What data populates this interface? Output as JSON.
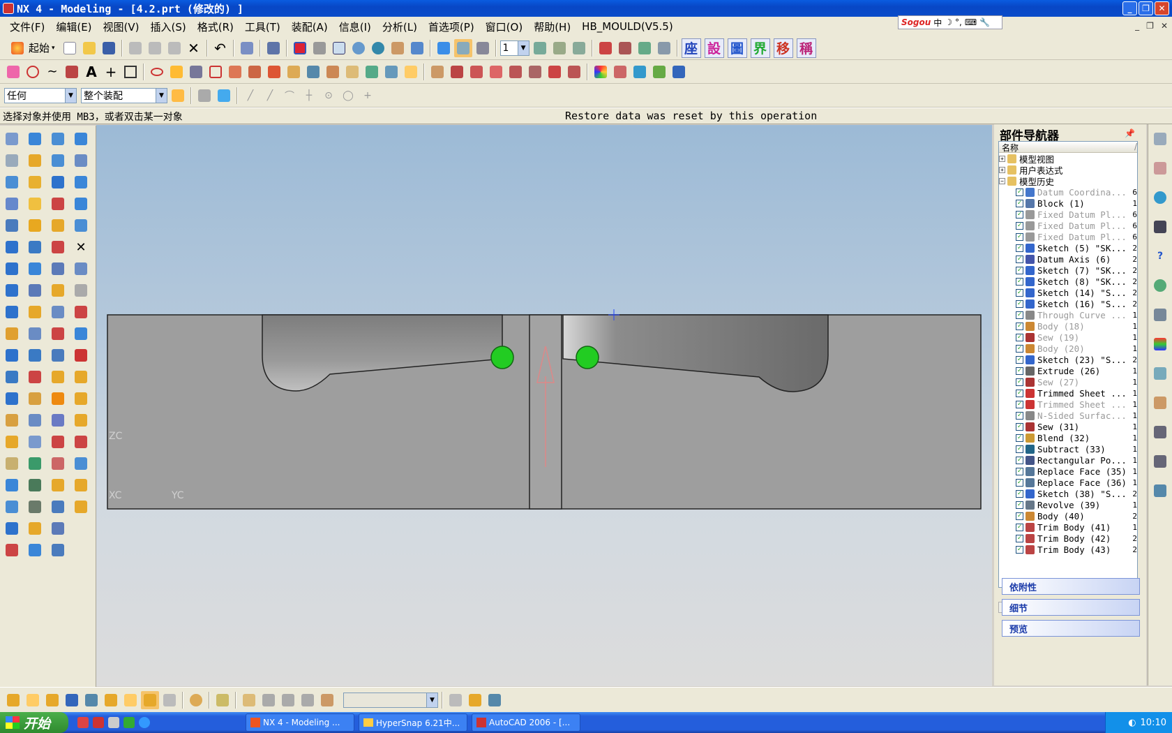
{
  "window": {
    "title": "NX 4 - Modeling - [4.2.prt  (修改的) ]",
    "minimize": "_",
    "restore": "❐",
    "close": "✕"
  },
  "menu": [
    "文件(F)",
    "编辑(E)",
    "视图(V)",
    "插入(S)",
    "格式(R)",
    "工具(T)",
    "装配(A)",
    "信息(I)",
    "分析(L)",
    "首选项(P)",
    "窗口(O)",
    "帮助(H)",
    "HB_MOULD(V5.5)"
  ],
  "ime": {
    "logo": "Sogou",
    "lang": "中"
  },
  "toolbar": {
    "start_label": "起始",
    "layer_value": "1",
    "filter_value": "任何",
    "scope_value": "整个装配",
    "kanji": [
      "座",
      "設",
      "圖",
      "界",
      "移",
      "稱"
    ],
    "kanji_colors": [
      "#2244bb",
      "#cc2299",
      "#2255cc",
      "#22aa33",
      "#cc3322",
      "#bb2277"
    ]
  },
  "status": {
    "prompt": "选择对象并使用 MB3，或者双击某一对象",
    "message": "Restore data was reset by this operation"
  },
  "viewport": {
    "labels": [
      "ZC",
      "XC",
      "YC"
    ],
    "selection_color": "#22cc22",
    "model_color": "#9a9a9a"
  },
  "part_navigator": {
    "title": "部件导航器",
    "column_header": "名称",
    "groups": [
      {
        "label": "模型视图",
        "exp": "+"
      },
      {
        "label": "用户表达式",
        "exp": "+"
      },
      {
        "label": "模型历史",
        "exp": "−"
      }
    ],
    "history": [
      {
        "label": "Datum Coordina...",
        "tail": "6",
        "dim": true,
        "color": "#4477cc"
      },
      {
        "label": "Block (1)",
        "tail": "1",
        "dim": false,
        "color": "#5577aa"
      },
      {
        "label": "Fixed Datum Pl...",
        "tail": "6",
        "dim": true,
        "color": "#999999"
      },
      {
        "label": "Fixed Datum Pl...",
        "tail": "6",
        "dim": true,
        "color": "#999999"
      },
      {
        "label": "Fixed Datum Pl...",
        "tail": "6",
        "dim": true,
        "color": "#999999"
      },
      {
        "label": "Sketch (5) \"SK...",
        "tail": "2",
        "dim": false,
        "color": "#3366cc"
      },
      {
        "label": "Datum Axis (6)",
        "tail": "2",
        "dim": false,
        "color": "#4455aa"
      },
      {
        "label": "Sketch (7) \"SK...",
        "tail": "2",
        "dim": false,
        "color": "#3366cc"
      },
      {
        "label": "Sketch (8) \"SK...",
        "tail": "2",
        "dim": false,
        "color": "#3366cc"
      },
      {
        "label": "Sketch (14) \"S...",
        "tail": "2",
        "dim": false,
        "color": "#3366cc"
      },
      {
        "label": "Sketch (16) \"S...",
        "tail": "2",
        "dim": false,
        "color": "#3366cc"
      },
      {
        "label": "Through Curve ...",
        "tail": "1",
        "dim": true,
        "color": "#888888"
      },
      {
        "label": "Body (18)",
        "tail": "1",
        "dim": true,
        "color": "#cc8833"
      },
      {
        "label": "Sew (19)",
        "tail": "1",
        "dim": true,
        "color": "#aa3333"
      },
      {
        "label": "Body (20)",
        "tail": "1",
        "dim": true,
        "color": "#cc8833"
      },
      {
        "label": "Sketch (23) \"S...",
        "tail": "2",
        "dim": false,
        "color": "#3366cc"
      },
      {
        "label": "Extrude (26)",
        "tail": "1",
        "dim": false,
        "color": "#666666"
      },
      {
        "label": "Sew (27)",
        "tail": "1",
        "dim": true,
        "color": "#aa3333"
      },
      {
        "label": "Trimmed Sheet ...",
        "tail": "1",
        "dim": false,
        "color": "#cc3333"
      },
      {
        "label": "Trimmed Sheet ...",
        "tail": "1",
        "dim": true,
        "color": "#cc3333"
      },
      {
        "label": "N-Sided Surfac...",
        "tail": "1",
        "dim": true,
        "color": "#888888"
      },
      {
        "label": "Sew (31)",
        "tail": "1",
        "dim": false,
        "color": "#aa3333"
      },
      {
        "label": "Blend (32)",
        "tail": "1",
        "dim": false,
        "color": "#cc9933"
      },
      {
        "label": "Subtract (33)",
        "tail": "1",
        "dim": false,
        "color": "#226688"
      },
      {
        "label": "Rectangular Po...",
        "tail": "1",
        "dim": false,
        "color": "#445588"
      },
      {
        "label": "Replace Face (35)",
        "tail": "1",
        "dim": false,
        "color": "#557799"
      },
      {
        "label": "Replace Face (36)",
        "tail": "1",
        "dim": false,
        "color": "#557799"
      },
      {
        "label": "Sketch (38) \"S...",
        "tail": "2",
        "dim": false,
        "color": "#3366cc"
      },
      {
        "label": "Revolve (39)",
        "tail": "1",
        "dim": false,
        "color": "#667788"
      },
      {
        "label": "Body (40)",
        "tail": "2",
        "dim": false,
        "color": "#cc8833"
      },
      {
        "label": "Trim Body (41)",
        "tail": "1",
        "dim": false,
        "color": "#bb4444"
      },
      {
        "label": "Trim Body (42)",
        "tail": "2",
        "dim": false,
        "color": "#bb4444"
      },
      {
        "label": "Trim Body (43)",
        "tail": "2",
        "dim": false,
        "color": "#bb4444"
      }
    ],
    "panels": [
      "依附性",
      "细节",
      "预览"
    ]
  },
  "taskbar": {
    "start": "开始",
    "tasks": [
      "NX 4 - Modeling ...",
      "HyperSnap 6.21中...",
      "AutoCAD 2006 - [..."
    ],
    "clock": "10:10"
  }
}
